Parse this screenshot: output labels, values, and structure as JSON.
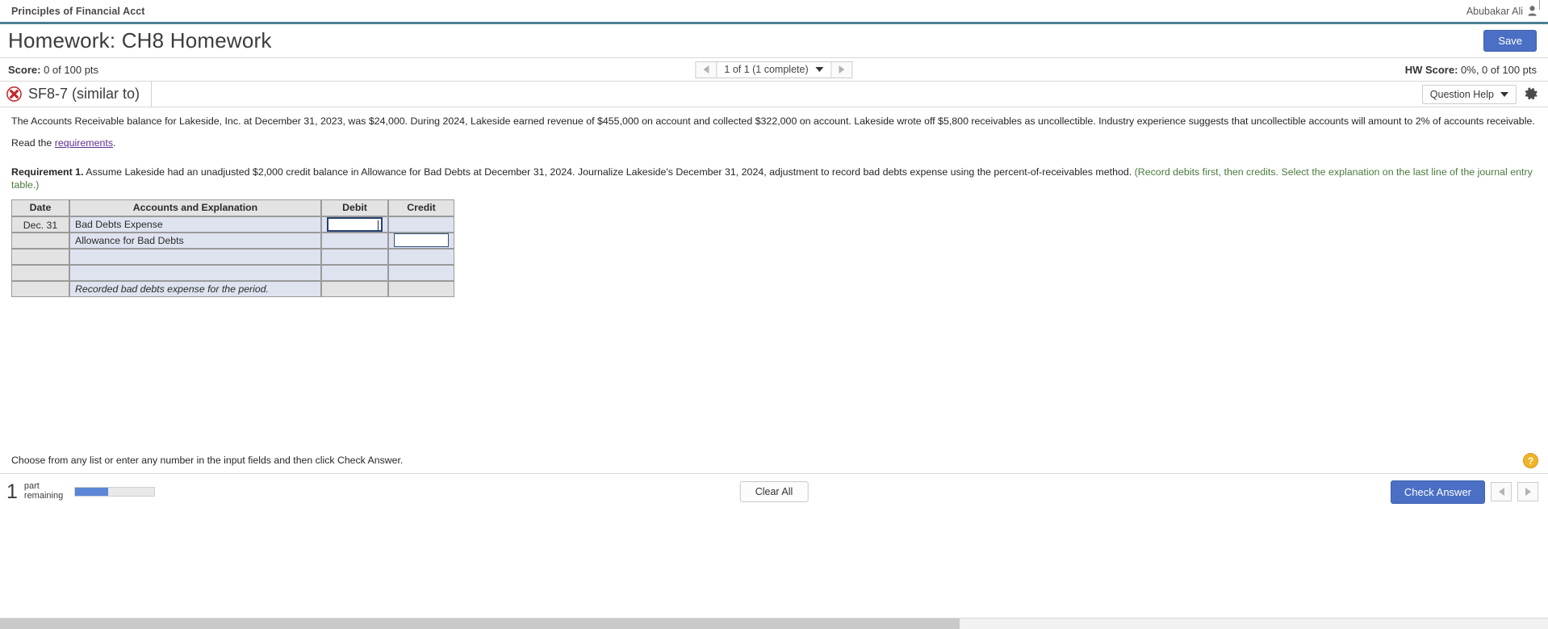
{
  "course": {
    "title": "Principles of Financial Acct",
    "user_name": "Abubakar Ali",
    "user_icon": "user-icon"
  },
  "header": {
    "title": "Homework: CH8 Homework",
    "save_label": "Save"
  },
  "score_bar": {
    "score_label": "Score:",
    "score_value": "0 of 100 pts",
    "pager_text": "1 of 1 (1 complete)",
    "prev_icon": "triangle-left-icon",
    "next_icon": "triangle-right-icon",
    "caret_icon": "caret-down-icon",
    "hw_score_label": "HW Score:",
    "hw_score_value": "0%, 0 of 100 pts"
  },
  "question_header": {
    "status_icon": "error-x-icon",
    "question_id": "SF8-7 (similar to)",
    "help_label": "Question Help",
    "help_caret_icon": "caret-down-icon",
    "settings_icon": "gear-icon"
  },
  "question": {
    "prompt": "The Accounts Receivable balance for Lakeside, Inc. at December 31, 2023, was $24,000. During 2024, Lakeside earned revenue of $455,000 on account and collected $322,000 on account. Lakeside wrote off $5,800 receivables as uncollectible. Industry experience suggests that uncollectible accounts will amount to 2% of accounts receivable.",
    "read_prefix": "Read the ",
    "read_link": "requirements",
    "read_suffix": ".",
    "requirement_label": "Requirement 1.",
    "requirement_text": " Assume Lakeside had an unadjusted $2,000 credit balance in Allowance for Bad Debts at December 31, 2024. Journalize Lakeside's December 31, 2024, adjustment to record bad debts expense using the percent-of-receivables method. ",
    "requirement_note": "(Record debits first, then credits. Select the explanation on the last line of the journal entry table.)"
  },
  "journal_table": {
    "columns": [
      "Date",
      "Accounts and Explanation",
      "Debit",
      "Credit"
    ],
    "rows": [
      {
        "date": "Dec. 31",
        "account": "Bad Debts Expense",
        "debit_input": "",
        "credit_input": null,
        "debit_focused": true
      },
      {
        "date": "",
        "account": "Allowance for Bad Debts",
        "debit_input": null,
        "credit_input": "",
        "debit_focused": false
      },
      {
        "date": "",
        "account": "",
        "debit_input": null,
        "credit_input": null,
        "debit_focused": false
      },
      {
        "date": "",
        "account": "",
        "debit_input": null,
        "credit_input": null,
        "debit_focused": false
      },
      {
        "date": "",
        "account": "Recorded bad debts expense for the period.",
        "debit_input": null,
        "credit_input": null,
        "debit_focused": false,
        "explanation": true
      }
    ]
  },
  "hint": {
    "text": "Choose from any list or enter any number in the input fields and then click Check Answer.",
    "help_icon": "question-mark-icon",
    "help_glyph": "?"
  },
  "footer": {
    "parts_number": "1",
    "parts_label_line1": "part",
    "parts_label_line2": "remaining",
    "progress_percent": 42,
    "progress_accent": "#5b87d6",
    "clear_all_label": "Clear All",
    "check_answer_label": "Check Answer",
    "prev_icon": "triangle-left-icon",
    "next_icon": "triangle-right-icon"
  },
  "colors": {
    "accent_blue": "#4a6fc4",
    "teal_rule": "#4d7e92",
    "error_red": "#c0272d",
    "note_green": "#4a7a3d",
    "link_purple": "#5b2d8e"
  }
}
